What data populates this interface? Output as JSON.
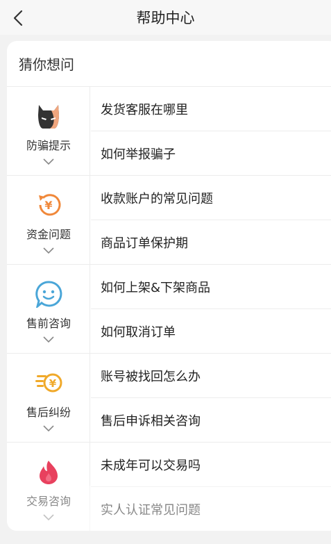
{
  "header": {
    "title": "帮助中心",
    "back_icon": "back-arrow-icon"
  },
  "card": {
    "title": "猜你想问"
  },
  "sections": [
    {
      "label": "防骗提示",
      "icon": "devil-mask-icon",
      "questions": [
        "发货客服在哪里",
        "如何举报骗子"
      ]
    },
    {
      "label": "资金问题",
      "icon": "yuan-refund-icon",
      "questions": [
        "收款账户的常见问题",
        "商品订单保护期"
      ]
    },
    {
      "label": "售前咨询",
      "icon": "smiley-chat-icon",
      "questions": [
        "如何上架&下架商品",
        "如何取消订单"
      ]
    },
    {
      "label": "售后纠纷",
      "icon": "yuan-coin-speed-icon",
      "questions": [
        "账号被找回怎么办",
        "售后申诉相关咨询"
      ]
    },
    {
      "label": "交易咨询",
      "icon": "flame-icon",
      "questions": [
        "未成年可以交易吗",
        "实人认证常见问题"
      ]
    }
  ],
  "colors": {
    "accent_orange": "#f0883a",
    "accent_blue": "#4aa6d8",
    "accent_gold": "#f0a92a",
    "accent_red": "#e8415e",
    "text_primary": "#222222",
    "background": "#f2f2f2"
  }
}
